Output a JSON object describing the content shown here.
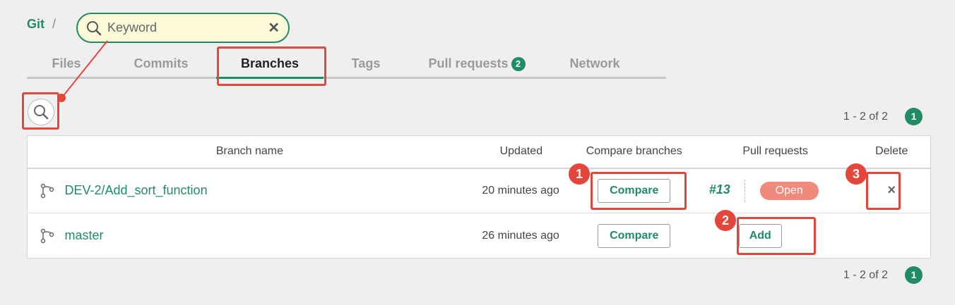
{
  "breadcrumb": {
    "root": "Git",
    "separator": "/"
  },
  "search": {
    "placeholder": "Keyword",
    "clear_icon": "close-icon"
  },
  "tabs": [
    {
      "label": "Files"
    },
    {
      "label": "Commits"
    },
    {
      "label": "Branches",
      "active": true
    },
    {
      "label": "Tags"
    },
    {
      "label": "Pull requests",
      "badge": "2"
    },
    {
      "label": "Network"
    }
  ],
  "pagination": {
    "range": "1 - 2 of 2",
    "page": "1"
  },
  "table": {
    "headers": [
      "Branch name",
      "Updated",
      "Compare branches",
      "Pull requests",
      "Delete"
    ],
    "rows": [
      {
        "name": "DEV-2/Add_sort_function",
        "updated": "20 minutes ago",
        "compare": "Compare",
        "pr_number": "#13",
        "pr_status": "Open",
        "delete": "×"
      },
      {
        "name": "master",
        "updated": "26 minutes ago",
        "compare": "Compare",
        "add": "Add"
      }
    ]
  },
  "callouts": [
    "1",
    "2",
    "3"
  ],
  "colors": {
    "accent": "#1f8c63",
    "highlight": "#e4463b",
    "open_badge": "#f08a7d"
  }
}
